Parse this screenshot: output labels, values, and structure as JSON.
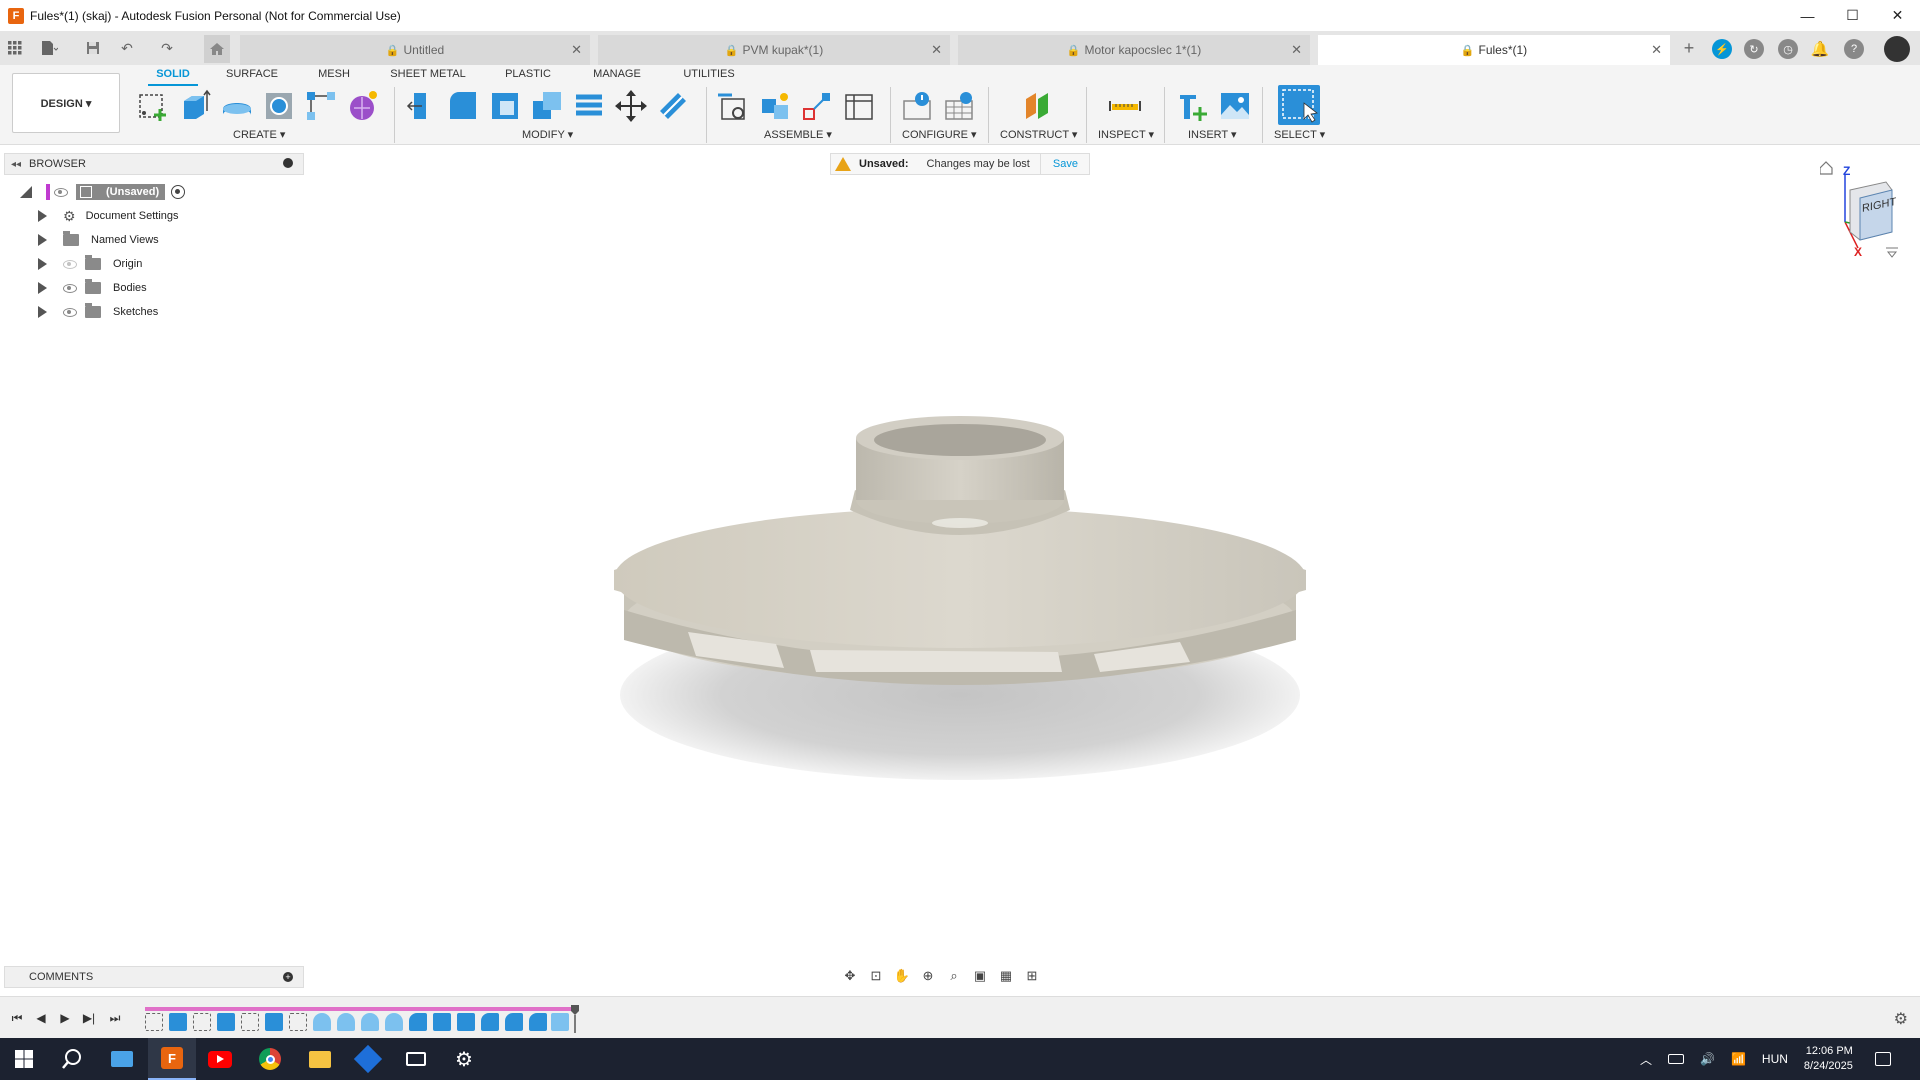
{
  "window": {
    "title": "Fules*(1) (skaj) - Autodesk Fusion Personal (Not for Commercial Use)",
    "app_icon_letter": "F",
    "minimize": "—",
    "maximize": "☐",
    "close": "✕"
  },
  "tabs": [
    {
      "label": "Untitled",
      "active": false
    },
    {
      "label": "PVM kupak*(1)",
      "active": false
    },
    {
      "label": "Motor kapocslec 1*(1)",
      "active": false
    },
    {
      "label": "Fules*(1)",
      "active": true
    }
  ],
  "toolbar": {
    "workspace_button": "DESIGN ▾",
    "workspace_tabs": [
      "SOLID",
      "SURFACE",
      "MESH",
      "SHEET METAL",
      "PLASTIC",
      "MANAGE",
      "UTILITIES"
    ],
    "active_tab": "SOLID",
    "groups": {
      "create": "CREATE ▾",
      "modify": "MODIFY ▾",
      "assemble": "ASSEMBLE ▾",
      "configure": "CONFIGURE ▾",
      "construct": "CONSTRUCT ▾",
      "inspect": "INSPECT ▾",
      "insert": "INSERT ▾",
      "select": "SELECT ▾"
    }
  },
  "browser": {
    "header": "BROWSER",
    "root": "(Unsaved)",
    "items": [
      "Document Settings",
      "Named Views",
      "Origin",
      "Bodies",
      "Sketches"
    ]
  },
  "banner": {
    "label": "Unsaved:",
    "message": "Changes may be lost",
    "action": "Save"
  },
  "viewcube": {
    "face": "RIGHT",
    "z_axis": "Z",
    "x_axis": "X"
  },
  "comments": {
    "label": "COMMENTS"
  },
  "taskbar": {
    "language": "HUN",
    "time": "12:06 PM",
    "date": "8/24/2025"
  },
  "colors": {
    "accent": "#0696d7",
    "timeline_bar": "#e070c8",
    "taskbar_bg": "#1c2230",
    "model_body": "#d8d5cc",
    "shadow": "#c9c9c9"
  }
}
